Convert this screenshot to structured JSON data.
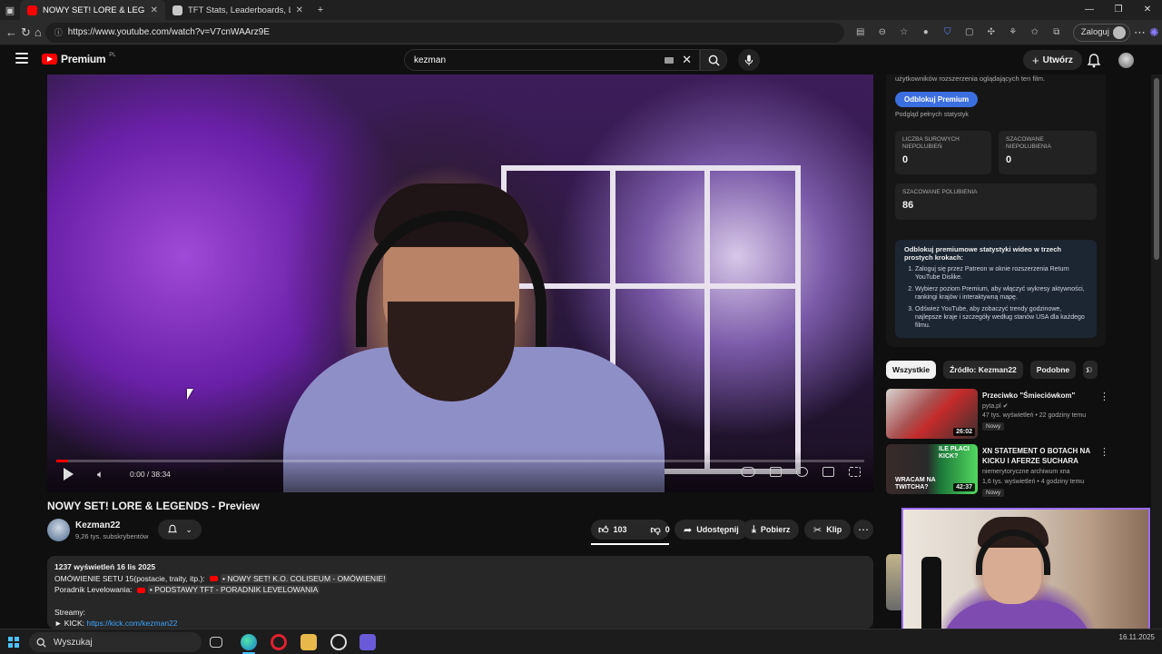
{
  "browser": {
    "tabs": [
      {
        "label": "NOWY SET! LORE & LEGENDS - P",
        "active": true
      },
      {
        "label": "TFT Stats, Leaderboards, League o",
        "active": false
      }
    ],
    "new_tab": "+",
    "url": "https://www.youtube.com/watch?v=V7cnWAArz9E",
    "login_label": "Zaloguj"
  },
  "youtube": {
    "logo_word": "Premium",
    "logo_country": "PL",
    "search_value": "kezman",
    "create_label": "Utwórz"
  },
  "player": {
    "time": "0:00 / 38:34",
    "progress_fraction": 0.0
  },
  "video": {
    "title": "NOWY SET! LORE & LEGENDS - Preview",
    "channel_name": "Kezman22",
    "channel_subs": "9,26 tys. subskrybentów",
    "likes": "103",
    "dislikes": "0",
    "share_label": "Udostępnij",
    "download_label": "Pobierz",
    "clip_label": "Klip"
  },
  "description": {
    "meta": "1237 wyświetleń  16 lis 2025",
    "line1_prefix": "OMÓWIENIE SETU 15(postacie, traity, itp.):",
    "line1_link": "• NOWY SET! K.O. COLISEUM - OMÓWIENIE!",
    "line2_prefix": "Poradnik Levelowania:",
    "line2_link": "• PODSTAWY TFT - PORADNIK LEVELOWANIA",
    "streamy": "Streamy:",
    "kick_label": "► KICK:",
    "kick_url": "https://kick.com/kezman22"
  },
  "stats_panel": {
    "note": "użytkowników rozszerzenia oglądających ten film.",
    "unlock_button": "Odblokuj Premium",
    "full_stats_link": "Podgląd pełnych statystyk",
    "boxes": [
      {
        "label": "LICZBA SUROWYCH NIEPOLUBIEŃ",
        "value": "0"
      },
      {
        "label": "SZACOWANE NIEPOLUBIENIA",
        "value": "0"
      },
      {
        "label": "SZACOWANE POLUBIENIA",
        "value": "86"
      }
    ],
    "promo_title": "Odblokuj premiumowe statystyki wideo w trzech prostych krokach:",
    "promo_steps": [
      "Zaloguj się przez Patreon w oknie rozszerzenia Return YouTube Dislike.",
      "Wybierz poziom Premium, aby włączyć wykresy aktywności, rankingi krajów i interaktywną mapę.",
      "Odśwież YouTube, aby zobaczyć trendy godzinowe, najlepsze kraje i szczegóły według stanów USA dla każdego filmu."
    ]
  },
  "chips": [
    "Wszystkie",
    "Źródło: Kezman22",
    "Podobne",
    "D"
  ],
  "recommendations": [
    {
      "title": "Przeciwko \"Śmieciówkom\"",
      "channel": "pyta.pl",
      "meta": "47 tys. wyświetleń • 22 godziny temu",
      "badge": "Nowy",
      "duration": "26:02"
    },
    {
      "title": "XN STATEMENT O BOTACH NA KICKU I AFERZE SUCHARA",
      "channel": "niemerytoryczne archiwum xna",
      "meta": "1,6 tys. wyświetleń • 4 godziny temu",
      "badge": "Nowy",
      "duration": "42:37",
      "thumb_text_top": "ILE PŁACI KICK?",
      "thumb_text_bottom": "WRACAM NA TWITCHA?"
    }
  ],
  "taskbar": {
    "search_placeholder": "Wyszukaj",
    "date": "16.11.2025"
  },
  "colors": {
    "yt_red": "#ff0000",
    "accent_blue": "#3ea6ff",
    "unlock_blue": "#3b6fe0"
  }
}
